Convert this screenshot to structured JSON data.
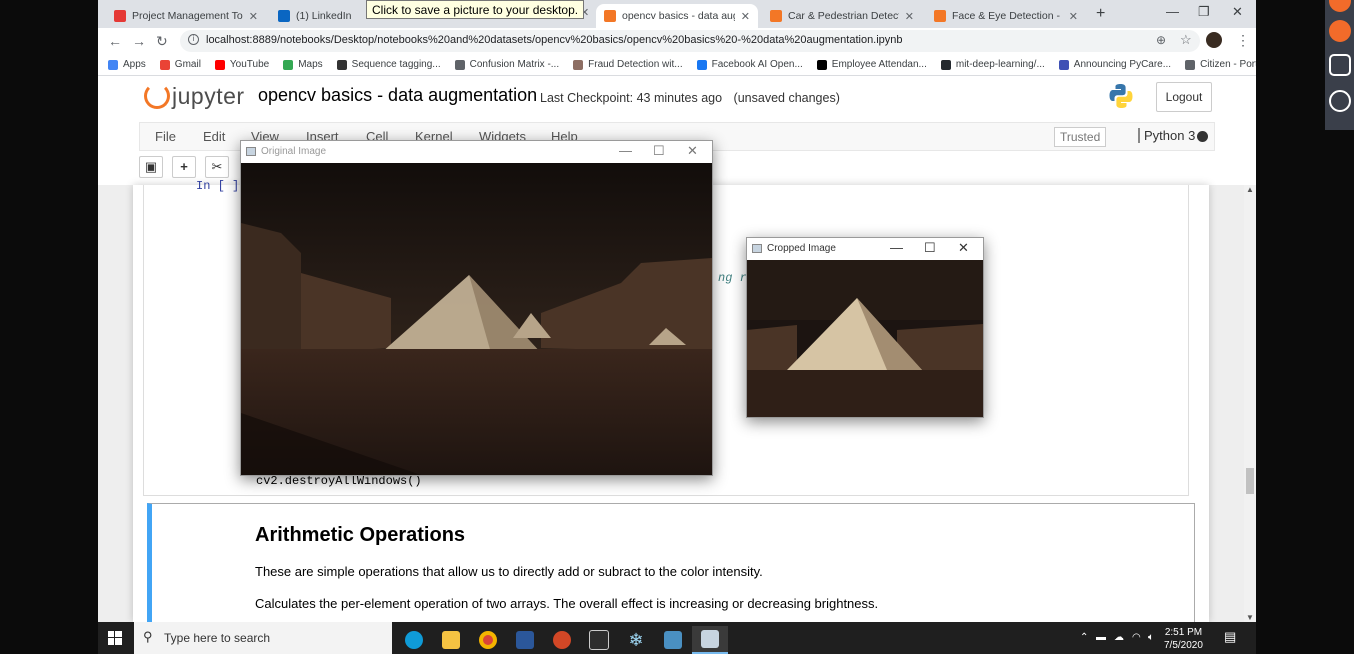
{
  "browser": {
    "tabs": [
      {
        "title": "Project Management Tool - P",
        "color": "#e53935"
      },
      {
        "title": "(1) LinkedIn",
        "color": "#0a66c2"
      },
      {
        "title": "opencv basics - data augmen",
        "color": "#f37726",
        "active": true
      },
      {
        "title": "Car & Pedestrian Detection",
        "color": "#f37726"
      },
      {
        "title": "Face & Eye Detection - Jupyt",
        "color": "#f37726"
      }
    ],
    "tooltip": "Click to save a picture to your desktop.",
    "url": "localhost:8889/notebooks/Desktop/notebooks%20and%20datasets/opencv%20basics/opencv%20basics%20-%20data%20augmentation.ipynb",
    "bookmarks": [
      {
        "label": "Apps",
        "color": "#4285f4"
      },
      {
        "label": "Gmail",
        "color": "#ea4335"
      },
      {
        "label": "YouTube",
        "color": "#ff0000"
      },
      {
        "label": "Maps",
        "color": "#34a853"
      },
      {
        "label": "Sequence tagging...",
        "color": "#333333"
      },
      {
        "label": "Confusion Matrix -...",
        "color": "#5f6368"
      },
      {
        "label": "Fraud Detection wit...",
        "color": "#8d6e63"
      },
      {
        "label": "Facebook AI Open...",
        "color": "#1877f2"
      },
      {
        "label": "Employee Attendan...",
        "color": "#000000"
      },
      {
        "label": "mit-deep-learning/...",
        "color": "#24292e"
      },
      {
        "label": "Announcing PyCare...",
        "color": "#3f51b5"
      },
      {
        "label": "Citizen - Portal",
        "color": "#5f6368"
      }
    ],
    "bookmarks_more": "»"
  },
  "jupyter": {
    "logo_text": "jupyter",
    "notebook_title": "opencv basics - data augmentation",
    "checkpoint": "Last Checkpoint: 43 minutes ago",
    "unsaved": "(unsaved changes)",
    "logout": "Logout",
    "menu": [
      "File",
      "Edit",
      "View",
      "Insert",
      "Cell",
      "Kernel",
      "Widgets",
      "Help"
    ],
    "trusted": "Trusted",
    "kernel": "Python 3"
  },
  "notebook": {
    "prompt": "In [ ]:",
    "code_fragment": "ng re",
    "code_last_line": "cv2.destroyAllWindows()",
    "md_heading": "Arithmetic Operations",
    "md_p1": "These are simple operations that allow us to directly add or subract to the color intensity.",
    "md_p2": "Calculates the per-element operation of two arrays. The overall effect is increasing or decreasing brightness."
  },
  "windows": {
    "original_title": "Original Image",
    "cropped_title": "Cropped Image"
  },
  "taskbar": {
    "search_placeholder": "Type here to search",
    "time": "2:51 PM",
    "date": "7/5/2020"
  }
}
